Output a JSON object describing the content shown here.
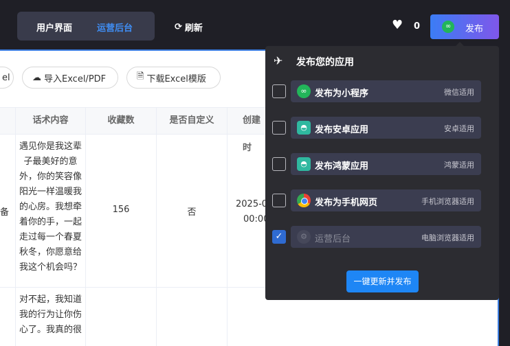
{
  "header": {
    "tabs": [
      {
        "label": "用户界面"
      },
      {
        "label": "运营后台"
      }
    ],
    "refresh_label": "刷新",
    "like_count": "0",
    "publish_label": "发布"
  },
  "toolbar": {
    "partial_left": "el",
    "import_label": "导入Excel/PDF",
    "download_label": "下载Excel模版"
  },
  "table": {
    "columns": [
      "话术内容",
      "收藏数",
      "是否自定义",
      "创建时"
    ],
    "left_partial": "备",
    "rows": [
      {
        "content_lines": [
          "遇见你是我这辈",
          "子最美好的意",
          "外，你的笑容像",
          "阳光一样温暖我",
          "的心房。我想牵",
          "着你的手，一起",
          "走过每一个春夏",
          "秋冬，你愿意给",
          "我这个机会吗？"
        ],
        "favorites": "156",
        "custom": "否",
        "created_lines": [
          "2025-0",
          "00:00"
        ]
      },
      {
        "content_lines": [
          "对不起，我知道",
          "我的行为让你伤",
          "心了。我真的很"
        ],
        "favorites": "",
        "custom": "",
        "created_lines": []
      }
    ]
  },
  "publish_menu": {
    "title": "发布您的应用",
    "options": [
      {
        "name": "发布为小程序",
        "tag": "微信适用",
        "checked": false,
        "icon": "wechat-mini-icon"
      },
      {
        "name": "发布安卓应用",
        "tag": "安卓适用",
        "checked": false,
        "icon": "android-icon"
      },
      {
        "name": "发布鸿蒙应用",
        "tag": "鸿蒙适用",
        "checked": false,
        "icon": "android-icon"
      },
      {
        "name": "发布为手机网页",
        "tag": "手机浏览器适用",
        "checked": false,
        "icon": "chrome-icon"
      },
      {
        "name": "运营后台",
        "tag": "电脑浏览器适用",
        "checked": true,
        "icon": "gear-icon"
      }
    ],
    "confirm_label": "一键更新并发布"
  }
}
